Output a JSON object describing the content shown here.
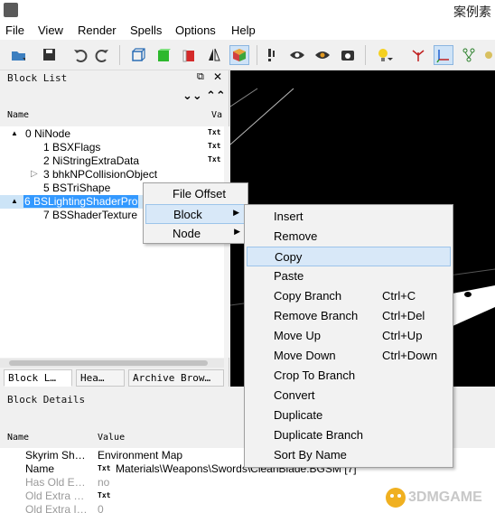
{
  "window": {
    "title": "案例素"
  },
  "menubar": [
    "File",
    "View",
    "Render",
    "Spells",
    "Options",
    "Help"
  ],
  "toolbar": {
    "icons": [
      "open-icon",
      "save-icon",
      "undo-icon",
      "redo-icon",
      "box-wire-icon",
      "box-green-icon",
      "box-red-icon",
      "mirror-icon",
      "box-textured-icon",
      "exclaim-icon",
      "eye-icon",
      "eye-hide-icon",
      "screenshot-icon",
      "bulb-icon",
      "axes-icon",
      "gizmo-icon",
      "nodes-icon"
    ]
  },
  "blocklist": {
    "title": "Block List",
    "columns": {
      "name": "Name",
      "value": "Va"
    },
    "rows": [
      {
        "expander": "▲",
        "label": "0 NiNode",
        "txt": "Txt"
      },
      {
        "expander": "",
        "label": "1 BSXFlags",
        "txt": "Txt"
      },
      {
        "expander": "",
        "label": "2 NiStringExtraData",
        "txt": "Txt"
      },
      {
        "expander": "▷",
        "label": "3 bhkNPCollisionObject",
        "txt": ""
      },
      {
        "expander": "",
        "label": "5 BSTriShape",
        "txt": ""
      },
      {
        "expander": "▲",
        "label": "6 BSLightingShaderPro",
        "txt": ""
      },
      {
        "expander": "",
        "label": "7 BSShaderTexture",
        "txt": ""
      }
    ],
    "tabs": [
      "Block L…",
      "Hea…",
      "Archive Brow…"
    ]
  },
  "details": {
    "title": "Block Details",
    "columns": {
      "name": "Name",
      "value": "Value"
    },
    "rows": [
      {
        "name": "Skyrim Sh…",
        "value": "Environment Map",
        "txt": ""
      },
      {
        "name": "Name",
        "value": "Materials\\Weapons\\Swords\\CleanBlade.BGSM [7]",
        "txt": "Txt"
      },
      {
        "name": "Has Old E…",
        "value": "no",
        "txt": ""
      },
      {
        "name": "Old Extra …",
        "value": "",
        "txt": "Txt"
      },
      {
        "name": "Old Extra I…",
        "value": "0",
        "txt": ""
      }
    ]
  },
  "context_menu": {
    "items": [
      {
        "label": "File Offset",
        "submenu": false
      },
      {
        "label": "Block",
        "submenu": true
      },
      {
        "label": "Node",
        "submenu": true
      }
    ]
  },
  "submenu": {
    "items": [
      {
        "label": "Insert",
        "shortcut": ""
      },
      {
        "label": "Remove",
        "shortcut": ""
      },
      {
        "label": "Copy",
        "shortcut": ""
      },
      {
        "label": "Paste",
        "shortcut": ""
      },
      {
        "label": "Copy Branch",
        "shortcut": "Ctrl+C"
      },
      {
        "label": "Remove Branch",
        "shortcut": "Ctrl+Del"
      },
      {
        "label": "Move Up",
        "shortcut": "Ctrl+Up"
      },
      {
        "label": "Move Down",
        "shortcut": "Ctrl+Down"
      },
      {
        "label": "Crop To Branch",
        "shortcut": ""
      },
      {
        "label": "Convert",
        "shortcut": ""
      },
      {
        "label": "Duplicate",
        "shortcut": ""
      },
      {
        "label": "Duplicate Branch",
        "shortcut": ""
      },
      {
        "label": "Sort By Name",
        "shortcut": ""
      }
    ]
  },
  "watermark": {
    "text": "3DMGAME"
  },
  "colors": {
    "selection": "#3399ff",
    "viewport": "#000000",
    "menu_highlight": "#d8e8f8"
  }
}
